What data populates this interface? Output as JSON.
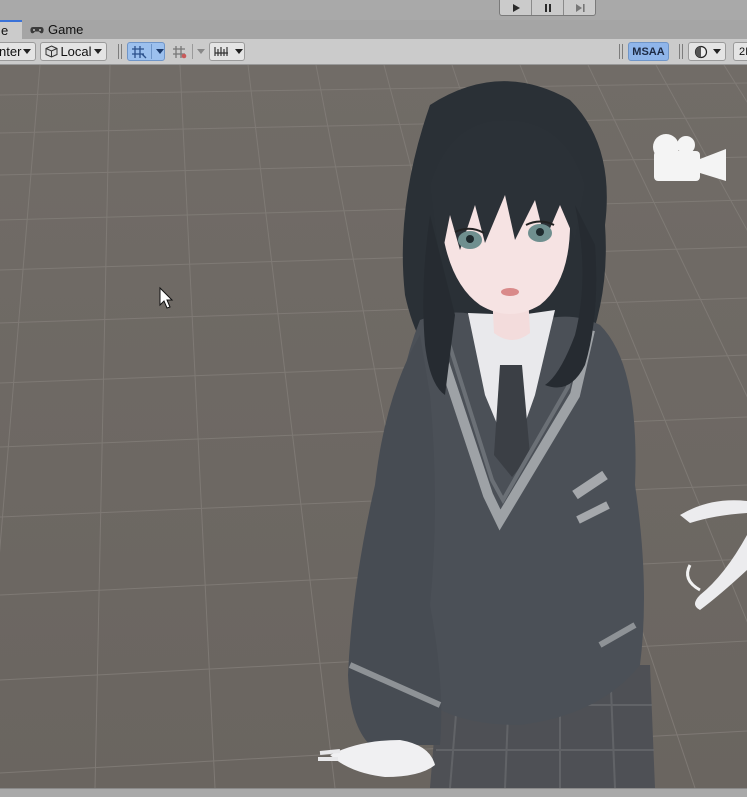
{
  "tabs": [
    {
      "label": "e",
      "active": true,
      "icon": "scene-hash-icon"
    },
    {
      "label": "Game",
      "active": false,
      "icon": "gamepad-icon"
    }
  ],
  "playbar": {
    "buttons": [
      "play-icon",
      "pause-icon",
      "step-icon"
    ]
  },
  "toolbar": {
    "pivot_label": "nter",
    "space_label": "Local",
    "msaa_label": "MSAA",
    "mode_2d_label": "2I"
  },
  "colors": {
    "accent": "#3a72d8",
    "active_toggle": "#9cc0ee",
    "msaa_bg": "#8fb5ea",
    "scene_bg": "#6d6964",
    "grid_line": "#8a8580"
  },
  "scene": {
    "gizmo_icon": "camera-gizmo-icon",
    "cursor_icon": "mouse-pointer-icon"
  }
}
